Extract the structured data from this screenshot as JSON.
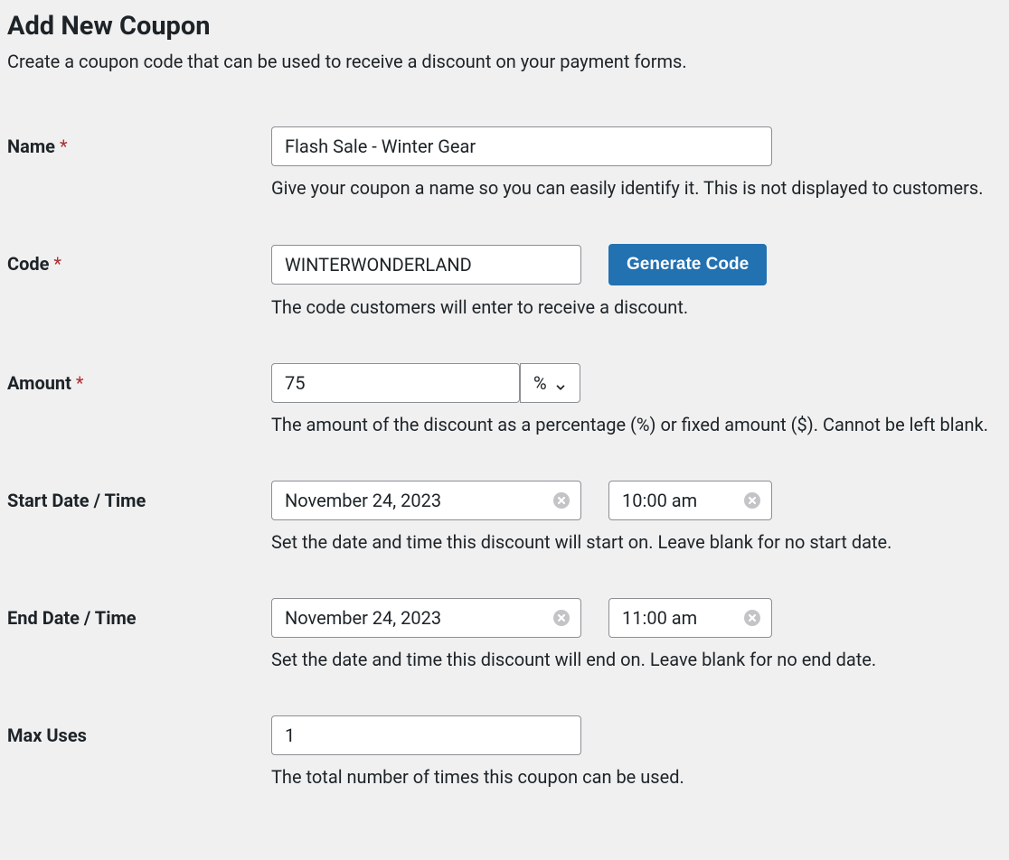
{
  "header": {
    "title": "Add New Coupon",
    "description": "Create a coupon code that can be used to receive a discount on your payment forms."
  },
  "fields": {
    "name": {
      "label": "Name",
      "required": "*",
      "value": "Flash Sale - Winter Gear",
      "help": "Give your coupon a name so you can easily identify it. This is not displayed to customers."
    },
    "code": {
      "label": "Code",
      "required": "*",
      "value": "WINTERWONDERLAND",
      "button": "Generate Code",
      "help": "The code customers will enter to receive a discount."
    },
    "amount": {
      "label": "Amount",
      "required": "*",
      "value": "75",
      "unit": "%",
      "help": "The amount of the discount as a percentage (%) or fixed amount ($). Cannot be left blank."
    },
    "start": {
      "label": "Start Date / Time",
      "date": "November 24, 2023",
      "time": "10:00 am",
      "help": "Set the date and time this discount will start on. Leave blank for no start date."
    },
    "end": {
      "label": "End Date / Time",
      "date": "November 24, 2023",
      "time": "11:00 am",
      "help": "Set the date and time this discount will end on. Leave blank for no end date."
    },
    "maxuses": {
      "label": "Max Uses",
      "value": "1",
      "help": "The total number of times this coupon can be used."
    }
  }
}
